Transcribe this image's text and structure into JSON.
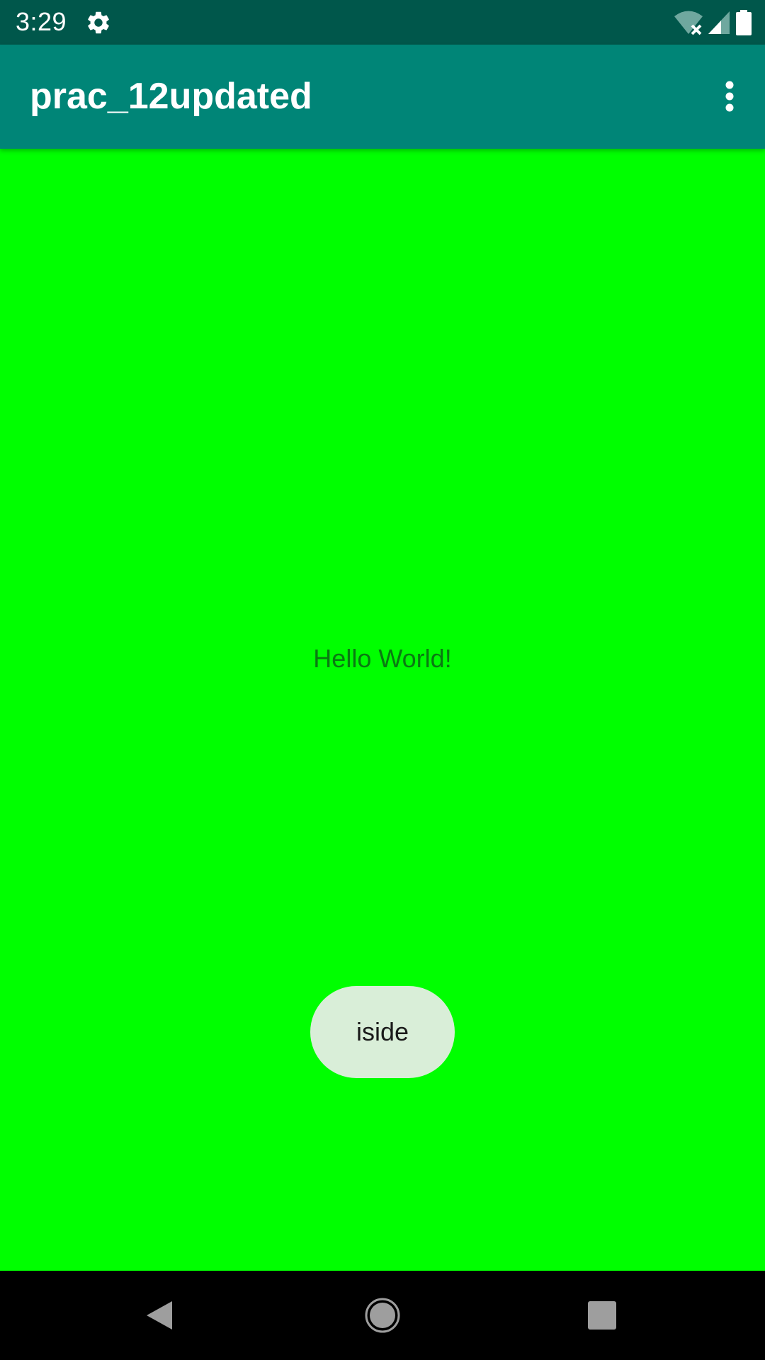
{
  "status_bar": {
    "time": "3:29",
    "icons": [
      "settings-gear-icon",
      "wifi-off-icon",
      "cell-signal-icon",
      "battery-icon"
    ],
    "background_color": "#00574B"
  },
  "app_bar": {
    "title": "prac_12updated",
    "overflow_icon": "more-vert-icon",
    "background_color": "#008577"
  },
  "main": {
    "background_color": "#00FF00",
    "text": "Hello World!"
  },
  "toast": {
    "text": "iside"
  },
  "nav_bar": {
    "buttons": [
      "back-icon",
      "home-icon",
      "recents-icon"
    ]
  }
}
